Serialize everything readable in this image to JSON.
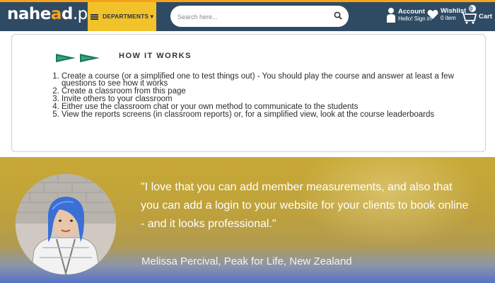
{
  "header": {
    "logo": {
      "prefix": "nahe",
      "mark": "a",
      "suffix": "d",
      "tld": ".pk"
    },
    "departments_label": "DEPARTMENTS ▾",
    "search_placeholder": "Search here...",
    "account": {
      "title": "Account",
      "subtitle": "Hello! Sign in"
    },
    "wishlist": {
      "title": "Wishlist",
      "subtitle": "0 item"
    },
    "cart": {
      "title": "Cart",
      "count": "0"
    }
  },
  "how_it_works": {
    "title": "HOW IT WORKS",
    "steps": [
      "Create a course (or a simplified one to test things out) - You should play the course and answer at least a few questions to see how it works",
      "Create a classroom from this page",
      "Invite others to your classroom",
      "Either use the classroom chat or your own method to communicate to the students",
      "View the reports screens (in classroom reports) or, for a simplified view, look at the course leaderboards"
    ]
  },
  "testimonial": {
    "quote": "\"I love that you can add member measurements, and also that you can add a login to your website for your clients to book online - and it looks professional.\"",
    "author": "Melissa Percival, Peak for Life, New Zealand"
  },
  "colors": {
    "header_bg": "#2f4b63",
    "header_accent": "#f7a11a",
    "departments_bg": "#f2c22a",
    "testimonial_band": "#c8a935"
  }
}
